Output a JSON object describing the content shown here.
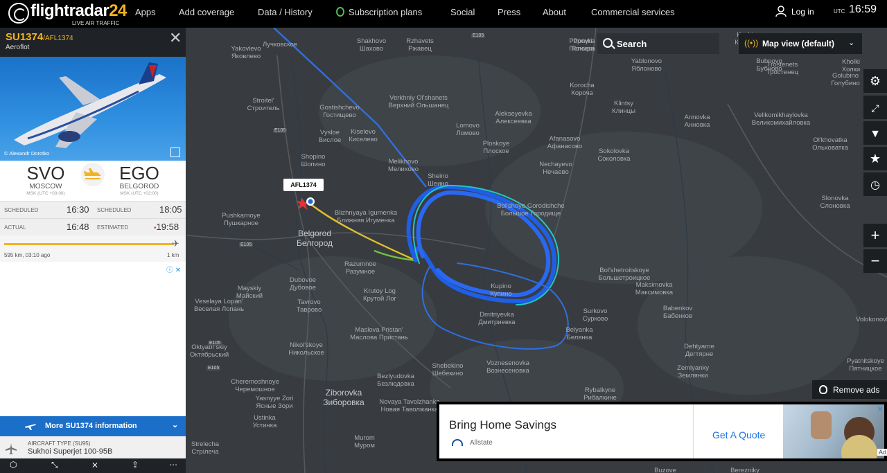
{
  "nav": {
    "logo_text": "flightradar",
    "logo_num": "24",
    "logo_sub": "LIVE AIR TRAFFIC",
    "items": [
      "Apps",
      "Add coverage",
      "Data / History",
      "Subscription plans",
      "Social",
      "Press",
      "About",
      "Commercial services"
    ],
    "login": "Log in",
    "utc": "UTC",
    "time": "16:59"
  },
  "flight": {
    "number": "SU1374",
    "callsign": "/AFL1374",
    "airline": "Aeroflot",
    "photo_credit": "© Alexandr Dorotko",
    "origin": {
      "code": "SVO",
      "city": "MOSCOW",
      "tz": "MSK (UTC +03:00)"
    },
    "dest": {
      "code": "EGO",
      "city": "BELGOROD",
      "tz": "MSK (UTC +03:00)"
    },
    "scheduled_label": "SCHEDULED",
    "actual_label": "ACTUAL",
    "estimated_label": "ESTIMATED",
    "dep_scheduled": "16:30",
    "dep_actual": "16:48",
    "arr_scheduled": "18:05",
    "arr_estimated": "19:58",
    "progress_left": "595 km, 03:10 ago",
    "progress_right": "1 km",
    "progress_fraction": 0.998,
    "more_info": "More SU1374 information",
    "aircraft_type_label": "AIRCRAFT TYPE",
    "aircraft_type_code": "(SU95)",
    "aircraft_type": "Sukhoi Superjet 100-95B"
  },
  "map": {
    "search_label": "Search",
    "map_view": "Map view (default)",
    "remove_ads": "Remove ads",
    "callout": "AFL1374",
    "controls": [
      "gear-icon",
      "fullscreen-icon",
      "filter-icon",
      "star-icon",
      "playback-icon",
      "zoom-in-icon",
      "zoom-out-icon"
    ],
    "places": [
      {
        "lat": "Лучковское",
        "ru": ""
      },
      {
        "lat": "Yakovlevo",
        "ru": "Яковлево"
      },
      {
        "lat": "Shakhovo",
        "ru": "Шахово"
      },
      {
        "lat": "Rzhavets",
        "ru": "Ржавец"
      },
      {
        "lat": "Ponyri",
        "ru": "Понири"
      },
      {
        "lat": "Stroitel'",
        "ru": "Строитель"
      },
      {
        "lat": "Gostishchevo",
        "ru": "Гостищево"
      },
      {
        "lat": "Verkhniy Ol'shanets",
        "ru": "Верхний Ольшанец"
      },
      {
        "lat": "Lomovo",
        "ru": "Ломово"
      },
      {
        "lat": "Alekseyevka",
        "ru": "Алексеевка"
      },
      {
        "lat": "Korocha",
        "ru": "Короча"
      },
      {
        "lat": "Klintsy",
        "ru": "Клинцы"
      },
      {
        "lat": "Vysloe",
        "ru": "Вислое"
      },
      {
        "lat": "Kiselevo",
        "ru": "Киселево"
      },
      {
        "lat": "Ploskoye",
        "ru": "Плоское"
      },
      {
        "lat": "Afanasovo",
        "ru": "Афанасово"
      },
      {
        "lat": "Sokolovka",
        "ru": "Соколовка"
      },
      {
        "lat": "Shopino",
        "ru": "Шопино"
      },
      {
        "lat": "Melikhovo",
        "ru": "Мелихово"
      },
      {
        "lat": "Nechayevo",
        "ru": "Нечаево"
      },
      {
        "lat": "Sheino",
        "ru": "Шеино"
      },
      {
        "lat": "Bol'shoye Gorodishche",
        "ru": "Большое Городище"
      },
      {
        "lat": "Pushkarnoye",
        "ru": "Пушкарное"
      },
      {
        "lat": "Blizhnyaya Igumenka",
        "ru": "Ближняя Игуменка"
      },
      {
        "lat": "Razumnoe",
        "ru": "Разумное"
      },
      {
        "lat": "Krutoy Log",
        "ru": "Крутой Лог"
      },
      {
        "lat": "Kupino",
        "ru": "Купино"
      },
      {
        "lat": "Mayskiy",
        "ru": "Майский"
      },
      {
        "lat": "Dubovoe",
        "ru": "Дубовое"
      },
      {
        "lat": "Tavrovo",
        "ru": "Таврово"
      },
      {
        "lat": "Veselaya Lopan'",
        "ru": "Веселая Лопань"
      },
      {
        "lat": "Dmitriyevka",
        "ru": "Дмитриевка"
      },
      {
        "lat": "Maslova Pristan'",
        "ru": "Маслова Пристань"
      },
      {
        "lat": "Surkovo",
        "ru": "Сурково"
      },
      {
        "lat": "Belyanka",
        "ru": "Белянка"
      },
      {
        "lat": "Bol'shetroitskoye",
        "ru": "Большетроицкое"
      },
      {
        "lat": "Maksimovka",
        "ru": "Максимовка"
      },
      {
        "lat": "Babenkov",
        "ru": "Бабенков"
      },
      {
        "lat": "Oktyabr'skiy",
        "ru": "Октябрьский"
      },
      {
        "lat": "Nikol'skoye",
        "ru": "Никольское"
      },
      {
        "lat": "Shebekino",
        "ru": "Шебекино"
      },
      {
        "lat": "Voznesenovka",
        "ru": "Вознесеновка"
      },
      {
        "lat": "Dehtyarne",
        "ru": "Дегтярне"
      },
      {
        "lat": "Cheremoshnoye",
        "ru": "Черемошное"
      },
      {
        "lat": "Yasnyye Zori",
        "ru": "Ясные Зори"
      },
      {
        "lat": "Bezlyudovka",
        "ru": "Безлюдовка"
      },
      {
        "lat": "Zemlyanky",
        "ru": "Землянки"
      },
      {
        "lat": "Ustinka",
        "ru": "Устинка"
      },
      {
        "lat": "Novaya Tavolzhanka",
        "ru": "Новая Таволжанка"
      },
      {
        "lat": "Rybalkyne",
        "ru": "Рибалкине"
      },
      {
        "lat": "Murom",
        "ru": "Муром"
      },
      {
        "lat": "Strelecha",
        "ru": "Стрілеча"
      },
      {
        "lat": "Pyatnitskoye",
        "ru": "Пятницкое"
      },
      {
        "lat": "Volokonovka",
        "ru": ""
      },
      {
        "lat": "Velikomikhaylovka",
        "ru": "Великомихайловка"
      },
      {
        "lat": "Annovka",
        "ru": "Анновка"
      },
      {
        "lat": "Ol'khovatka",
        "ru": "Ольховатка"
      },
      {
        "lat": "Slonovka",
        "ru": "Слоновка"
      },
      {
        "lat": "Bubnovo",
        "ru": "Бубново"
      },
      {
        "lat": "Trostenets",
        "ru": "Тростенец"
      },
      {
        "lat": "Golubino",
        "ru": "Голубино"
      },
      {
        "lat": "Kholki",
        "ru": "Холки"
      },
      {
        "lat": "Yablonovo",
        "ru": "Яблоново"
      },
      {
        "lat": "Kuzkino",
        "ru": "Кузькино"
      },
      {
        "lat": "Popovka",
        "ru": "Поповка"
      },
      {
        "lat": "Berezniky",
        "ru": ""
      },
      {
        "lat": "Buzove",
        "ru": ""
      }
    ],
    "city": {
      "lat": "Belgorod",
      "ru": "Белгород"
    },
    "city2": {
      "lat": "Ziborovka",
      "ru": "Зиборовка"
    },
    "roads": [
      "E105",
      "E105",
      "E105",
      "E105",
      "E105"
    ]
  },
  "ad": {
    "title": "Bring Home Savings",
    "brand": "Allstate",
    "cta": "Get A Quote",
    "badge": "Ad"
  }
}
